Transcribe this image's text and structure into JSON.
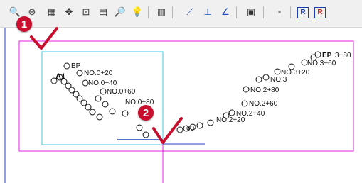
{
  "toolbar": {
    "buttons": [
      {
        "icon": "zoom-icon",
        "glyph": "🔍"
      },
      {
        "icon": "zoom-out-icon",
        "glyph": "⊖"
      },
      {
        "icon": "table-icon",
        "glyph": "▦"
      },
      {
        "icon": "move-icon",
        "glyph": "✥"
      },
      {
        "icon": "image-icon",
        "glyph": "⊡"
      },
      {
        "icon": "print-preview-icon",
        "glyph": "▤"
      },
      {
        "icon": "search-icon",
        "glyph": "🔎"
      },
      {
        "icon": "pin-icon",
        "glyph": "💡"
      },
      {
        "icon": "calculator-icon",
        "glyph": "▥"
      },
      {
        "icon": "line-icon",
        "glyph": "⟋"
      },
      {
        "icon": "angle-icon",
        "glyph": "⊥"
      },
      {
        "icon": "triangle-icon",
        "glyph": "∠"
      },
      {
        "icon": "document-icon",
        "glyph": "▣"
      },
      {
        "icon": "block-icon",
        "glyph": "▪"
      },
      {
        "icon": "report-icon",
        "glyph": "R"
      },
      {
        "icon": "report-delete-icon",
        "glyph": "R"
      }
    ]
  },
  "colors": {
    "accent_red": "#c8102e",
    "frame_magenta": "#e020e0",
    "frame_cyan": "#40c8e0",
    "line_blue": "#2040c0"
  },
  "steps": {
    "one": "1",
    "two": "2"
  },
  "points": [
    {
      "label": "BP"
    },
    {
      "label": "A1"
    },
    {
      "label": "NO.0+20"
    },
    {
      "label": "NO.0+40"
    },
    {
      "label": "NO.0+60"
    },
    {
      "label": "NO.0+80"
    },
    {
      "label": "NO.2+20"
    },
    {
      "label": "NO.2+40"
    },
    {
      "label": "NO.2+60"
    },
    {
      "label": "NO.2+80"
    },
    {
      "label": "NO.3"
    },
    {
      "label": "NO.3+20"
    },
    {
      "label": "NO.3+60"
    },
    {
      "label": "EP"
    },
    {
      "label": "3+80"
    },
    {
      "label": "60"
    }
  ]
}
